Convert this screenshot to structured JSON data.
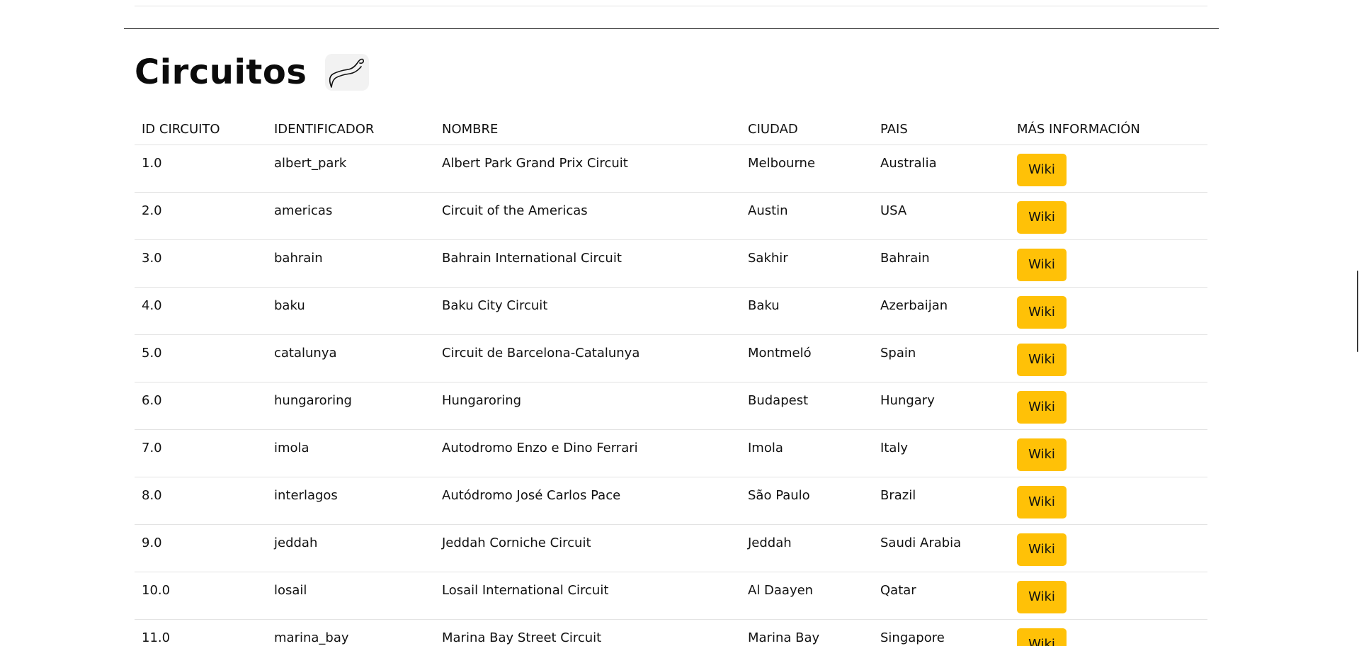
{
  "section": {
    "title": "Circuitos",
    "icon": "racetrack-icon"
  },
  "table": {
    "headers": [
      "ID CIRCUITO",
      "IDENTIFICADOR",
      "NOMBRE",
      "CIUDAD",
      "PAIS",
      "MÁS INFORMACIÓN"
    ],
    "rows": [
      {
        "id": "1.0",
        "ref": "albert_park",
        "name": "Albert Park Grand Prix Circuit",
        "city": "Melbourne",
        "country": "Australia",
        "button": "Wiki"
      },
      {
        "id": "2.0",
        "ref": "americas",
        "name": "Circuit of the Americas",
        "city": "Austin",
        "country": "USA",
        "button": "Wiki"
      },
      {
        "id": "3.0",
        "ref": "bahrain",
        "name": "Bahrain International Circuit",
        "city": "Sakhir",
        "country": "Bahrain",
        "button": "Wiki"
      },
      {
        "id": "4.0",
        "ref": "baku",
        "name": "Baku City Circuit",
        "city": "Baku",
        "country": "Azerbaijan",
        "button": "Wiki"
      },
      {
        "id": "5.0",
        "ref": "catalunya",
        "name": "Circuit de Barcelona-Catalunya",
        "city": "Montmeló",
        "country": "Spain",
        "button": "Wiki"
      },
      {
        "id": "6.0",
        "ref": "hungaroring",
        "name": "Hungaroring",
        "city": "Budapest",
        "country": "Hungary",
        "button": "Wiki"
      },
      {
        "id": "7.0",
        "ref": "imola",
        "name": "Autodromo Enzo e Dino Ferrari",
        "city": "Imola",
        "country": "Italy",
        "button": "Wiki"
      },
      {
        "id": "8.0",
        "ref": "interlagos",
        "name": "Autódromo José Carlos Pace",
        "city": "São Paulo",
        "country": "Brazil",
        "button": "Wiki"
      },
      {
        "id": "9.0",
        "ref": "jeddah",
        "name": "Jeddah Corniche Circuit",
        "city": "Jeddah",
        "country": "Saudi Arabia",
        "button": "Wiki"
      },
      {
        "id": "10.0",
        "ref": "losail",
        "name": "Losail International Circuit",
        "city": "Al Daayen",
        "country": "Qatar",
        "button": "Wiki"
      },
      {
        "id": "11.0",
        "ref": "marina_bay",
        "name": "Marina Bay Street Circuit",
        "city": "Marina Bay",
        "country": "Singapore",
        "button": "Wiki"
      }
    ]
  },
  "colors": {
    "wiki_button": "#ffc107",
    "divider": "#333333",
    "row_border": "#e3e3e3"
  }
}
